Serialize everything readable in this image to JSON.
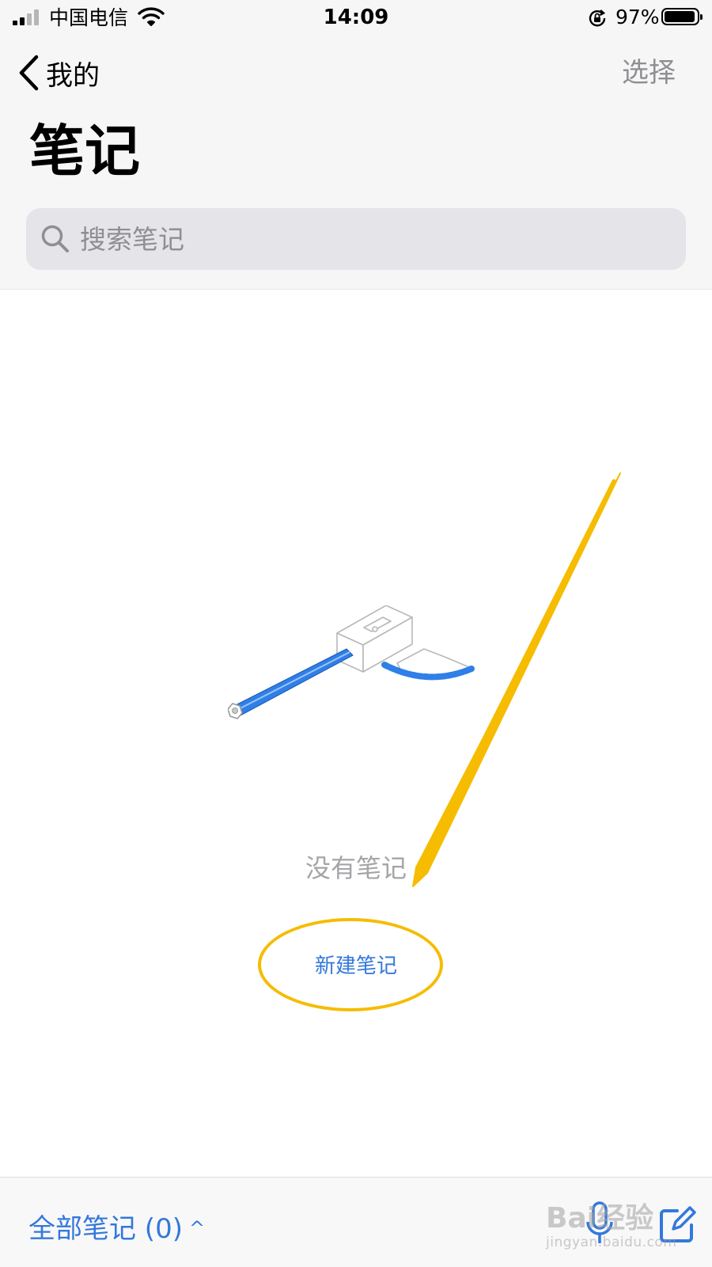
{
  "status_bar": {
    "carrier": "中国电信",
    "time": "14:09",
    "battery_percent": "97%",
    "battery_level": 0.97
  },
  "nav": {
    "back_label": "我的",
    "select_label": "选择"
  },
  "page_title": "笔记",
  "search": {
    "placeholder": "搜索笔记",
    "value": ""
  },
  "empty_state": {
    "message": "没有笔记",
    "new_note_label": "新建笔记"
  },
  "toolbar": {
    "folder_label": "全部笔记 (0)"
  },
  "watermark": {
    "text": "Bai经验",
    "url": "jingyan.baidu.com"
  },
  "colors": {
    "accent": "#3478db",
    "annotation": "#f6bc00",
    "pencil": "#2f7fe8"
  },
  "icons": [
    "back-chevron-icon",
    "search-icon",
    "pencil-sharpener-illustration",
    "microphone-icon",
    "compose-icon",
    "chevron-up-icon",
    "wifi-icon",
    "orientation-lock-icon"
  ]
}
